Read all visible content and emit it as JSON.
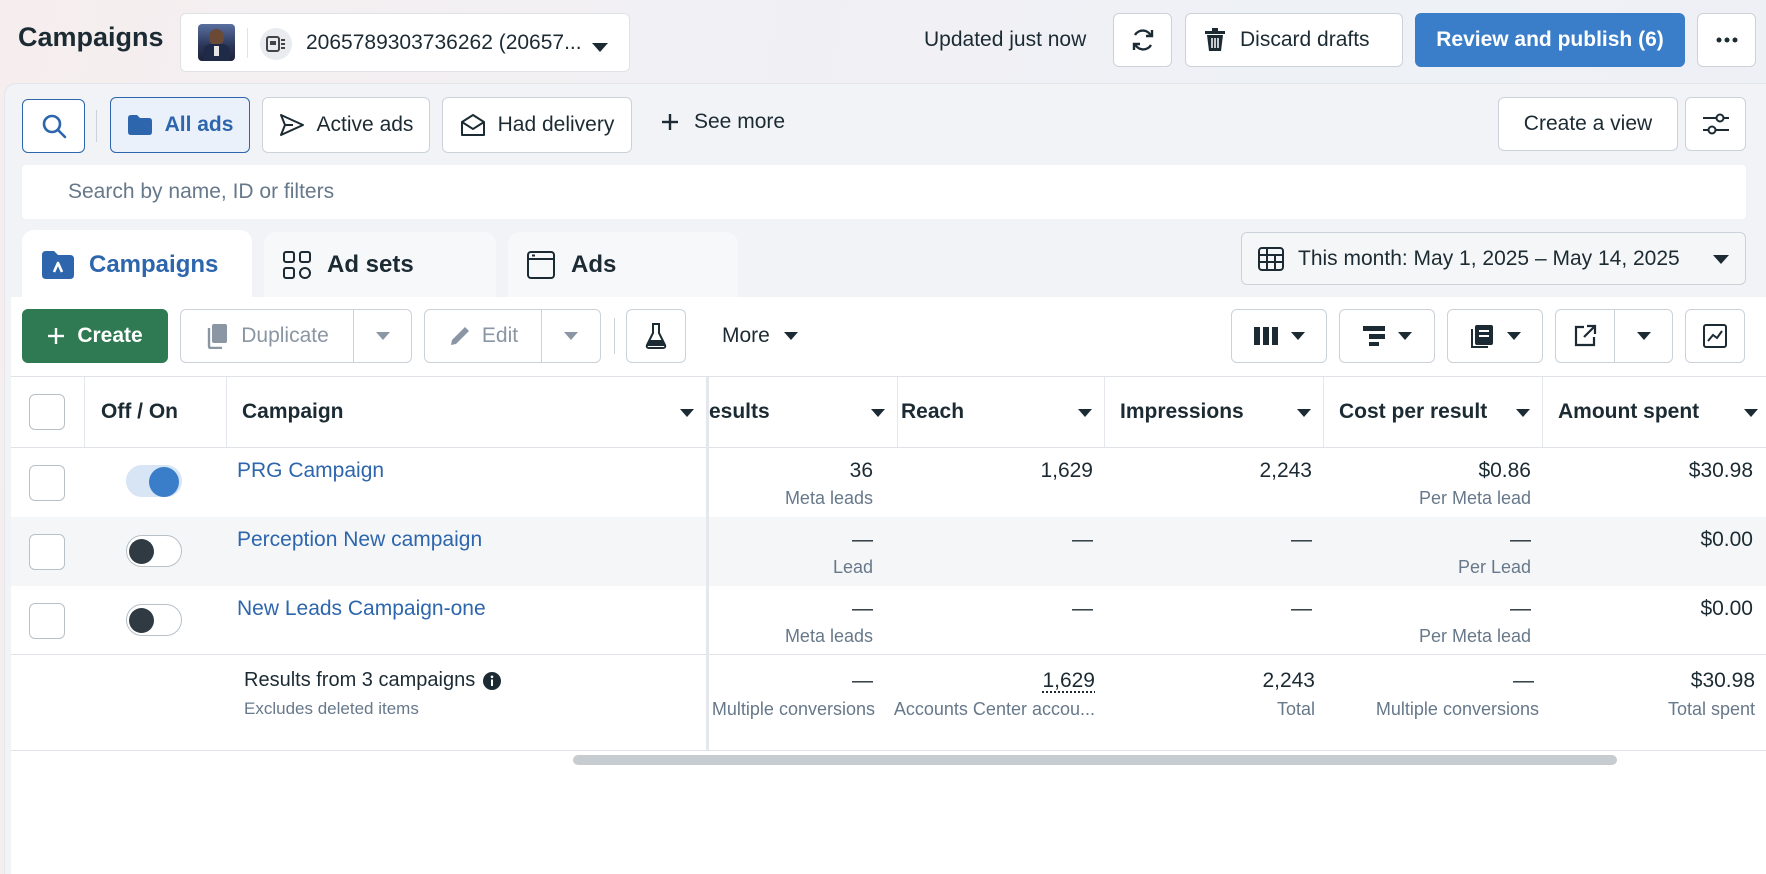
{
  "header": {
    "title": "Campaigns",
    "account_id": "2065789303736262 (20657...",
    "updated": "Updated just now",
    "discard_label": "Discard drafts",
    "publish_label": "Review and publish (6)"
  },
  "filters": {
    "all_ads": "All ads",
    "active_ads": "Active ads",
    "had_delivery": "Had delivery",
    "see_more": "See more",
    "create_view": "Create a view",
    "search_placeholder": "Search by name, ID or filters"
  },
  "tabs": {
    "campaigns": "Campaigns",
    "ad_sets": "Ad sets",
    "ads": "Ads"
  },
  "date_range": "This month: May 1, 2025 – May 14, 2025",
  "toolbar": {
    "create": "Create",
    "duplicate": "Duplicate",
    "edit": "Edit",
    "more": "More"
  },
  "columns": {
    "off_on": "Off / On",
    "campaign": "Campaign",
    "results": "esults",
    "reach": "Reach",
    "impressions": "Impressions",
    "cost_per_result": "Cost per result",
    "amount_spent": "Amount spent"
  },
  "rows": [
    {
      "name": "PRG Campaign",
      "on": true,
      "results": "36",
      "results_sub": "Meta leads",
      "reach": "1,629",
      "impressions": "2,243",
      "cpr": "$0.86",
      "cpr_sub": "Per Meta lead",
      "spent": "$30.98"
    },
    {
      "name": "Perception New campaign",
      "on": false,
      "results": "—",
      "results_sub": "Lead",
      "reach": "—",
      "impressions": "—",
      "cpr": "—",
      "cpr_sub": "Per Lead",
      "spent": "$0.00"
    },
    {
      "name": "New Leads Campaign-one",
      "on": false,
      "results": "—",
      "results_sub": "Meta leads",
      "reach": "—",
      "impressions": "—",
      "cpr": "—",
      "cpr_sub": "Per Meta lead",
      "spent": "$0.00"
    }
  ],
  "summary": {
    "label": "Results from 3 campaigns",
    "sub": "Excludes deleted items",
    "results": "—",
    "results_sub": "Multiple conversions",
    "reach": "1,629",
    "reach_sub": "Accounts Center accou...",
    "impressions": "2,243",
    "impressions_sub": "Total",
    "cpr": "—",
    "cpr_sub": "Multiple conversions",
    "spent": "$30.98",
    "spent_sub": "Total spent"
  },
  "colors": {
    "primary": "#2d66ac",
    "publish": "#3a7dc9",
    "create": "#2f7a52",
    "toggle_on": "#3a7dc9"
  }
}
